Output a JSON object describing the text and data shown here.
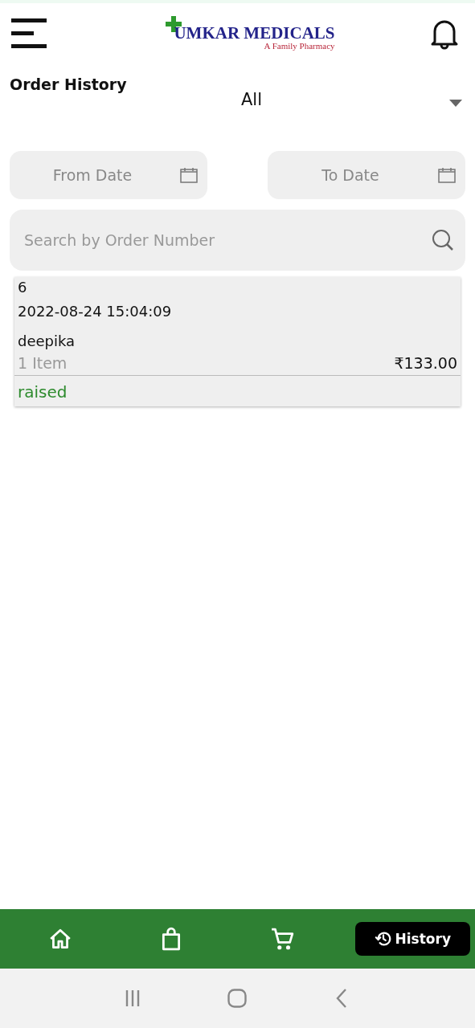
{
  "header": {
    "logo_name": "UMKAR MEDICALS",
    "logo_tagline": "A Family Pharmacy"
  },
  "page_title": "Order History",
  "status_filter": {
    "value": "All"
  },
  "date_filters": [
    {
      "placeholder": "From Date"
    },
    {
      "placeholder": "To Date"
    }
  ],
  "search": {
    "placeholder": "Search by Order Number"
  },
  "orders": [
    {
      "number": "6",
      "datetime": "2022-08-24 15:04:09",
      "customer": "deepika",
      "items": "1 Item",
      "total": "₹133.00",
      "status": "raised",
      "color": "#2e8b2e"
    }
  ],
  "bottom_nav": [
    {
      "kind": "home",
      "selected": false
    },
    {
      "kind": "bag",
      "selected": false
    },
    {
      "kind": "cart",
      "selected": false
    },
    {
      "kind": "history",
      "selected": true,
      "label": "History"
    }
  ]
}
